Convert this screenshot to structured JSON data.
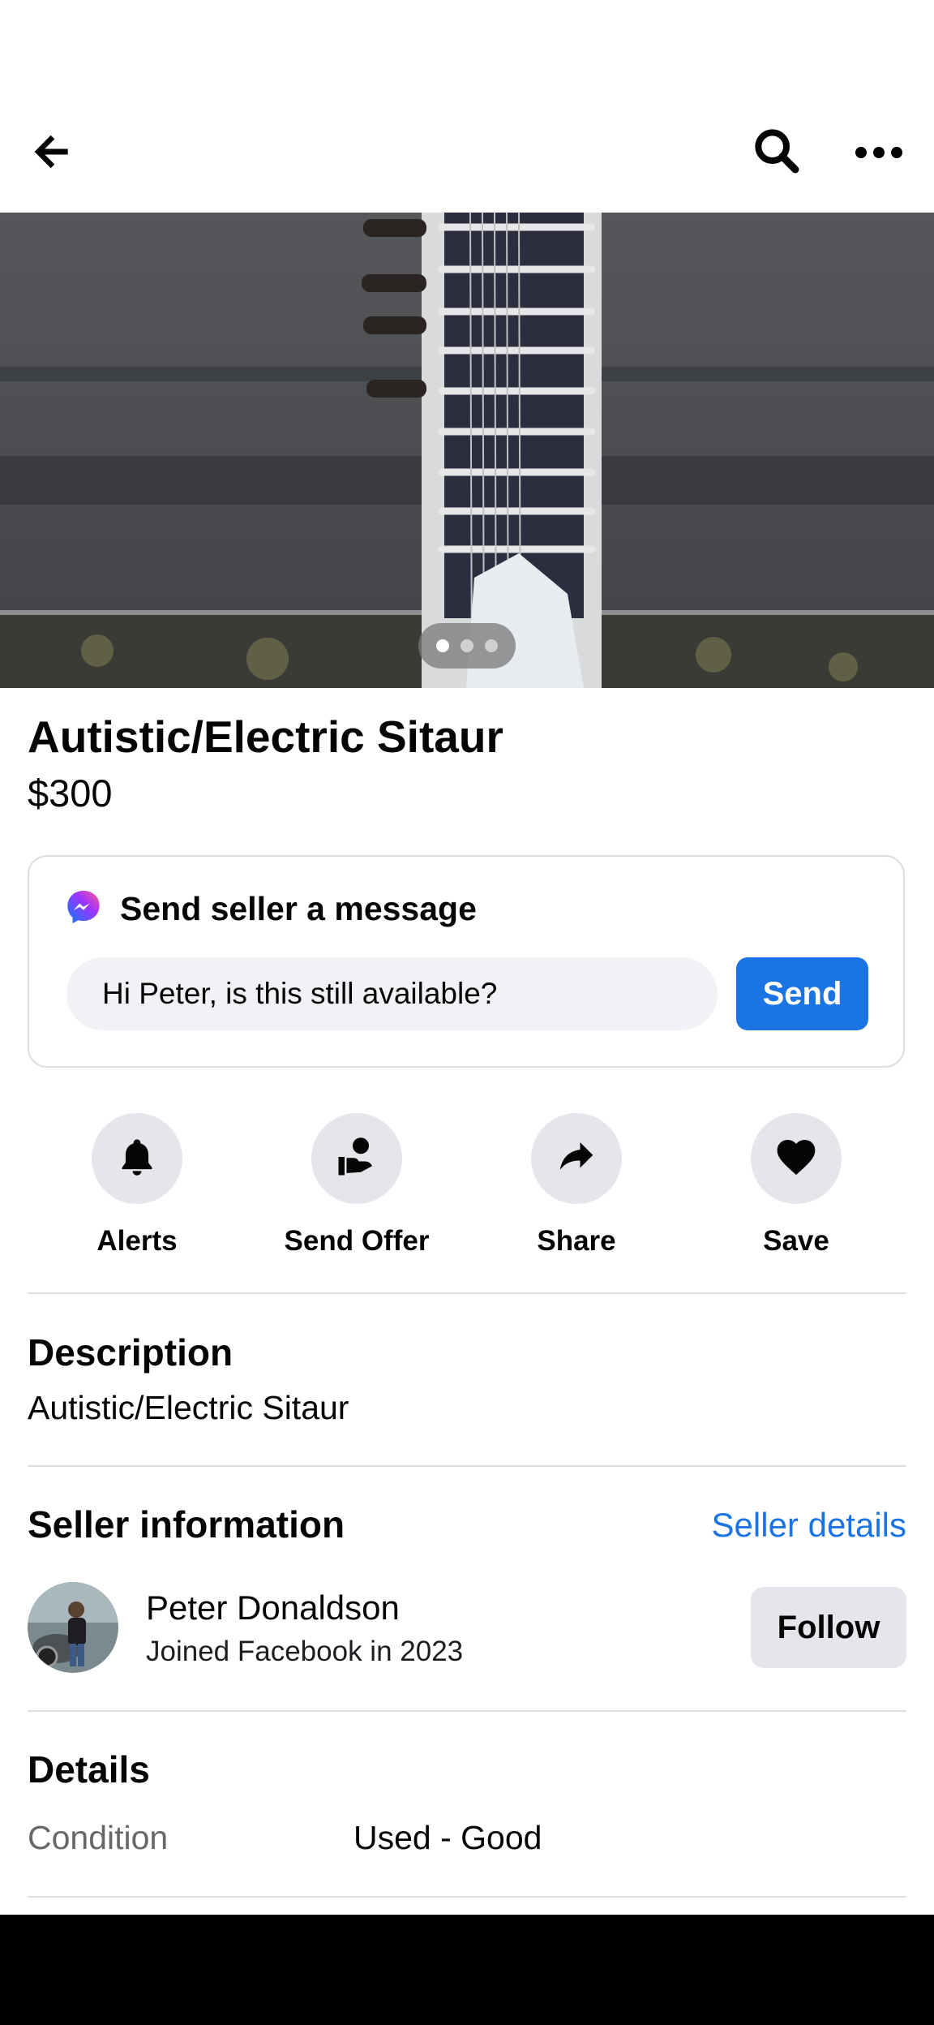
{
  "header": {
    "back_icon": "arrow-left-icon",
    "search_icon": "search-icon",
    "more_icon": "more-horizontal-icon"
  },
  "photo": {
    "page_count": 3,
    "current_page": 1
  },
  "listing": {
    "title": "Autistic/Electric Sitaur",
    "price": "$300"
  },
  "message": {
    "heading": "Send seller a message",
    "input_value": "Hi Peter, is this still available?",
    "send_label": "Send"
  },
  "actions": [
    {
      "label": "Alerts",
      "icon": "bell-icon"
    },
    {
      "label": "Send Offer",
      "icon": "offer-hand-icon"
    },
    {
      "label": "Share",
      "icon": "share-arrow-icon"
    },
    {
      "label": "Save",
      "icon": "heart-icon"
    }
  ],
  "description": {
    "heading": "Description",
    "text": "Autistic/Electric Sitaur"
  },
  "seller": {
    "heading": "Seller information",
    "details_link": "Seller details",
    "name": "Peter Donaldson",
    "joined": "Joined Facebook in 2023",
    "follow_label": "Follow"
  },
  "details": {
    "heading": "Details",
    "rows": [
      {
        "label": "Condition",
        "value": "Used - Good"
      }
    ]
  },
  "colors": {
    "accent": "#1b74e4",
    "button_gray": "#e4e6eb",
    "divider": "#dadde1"
  }
}
